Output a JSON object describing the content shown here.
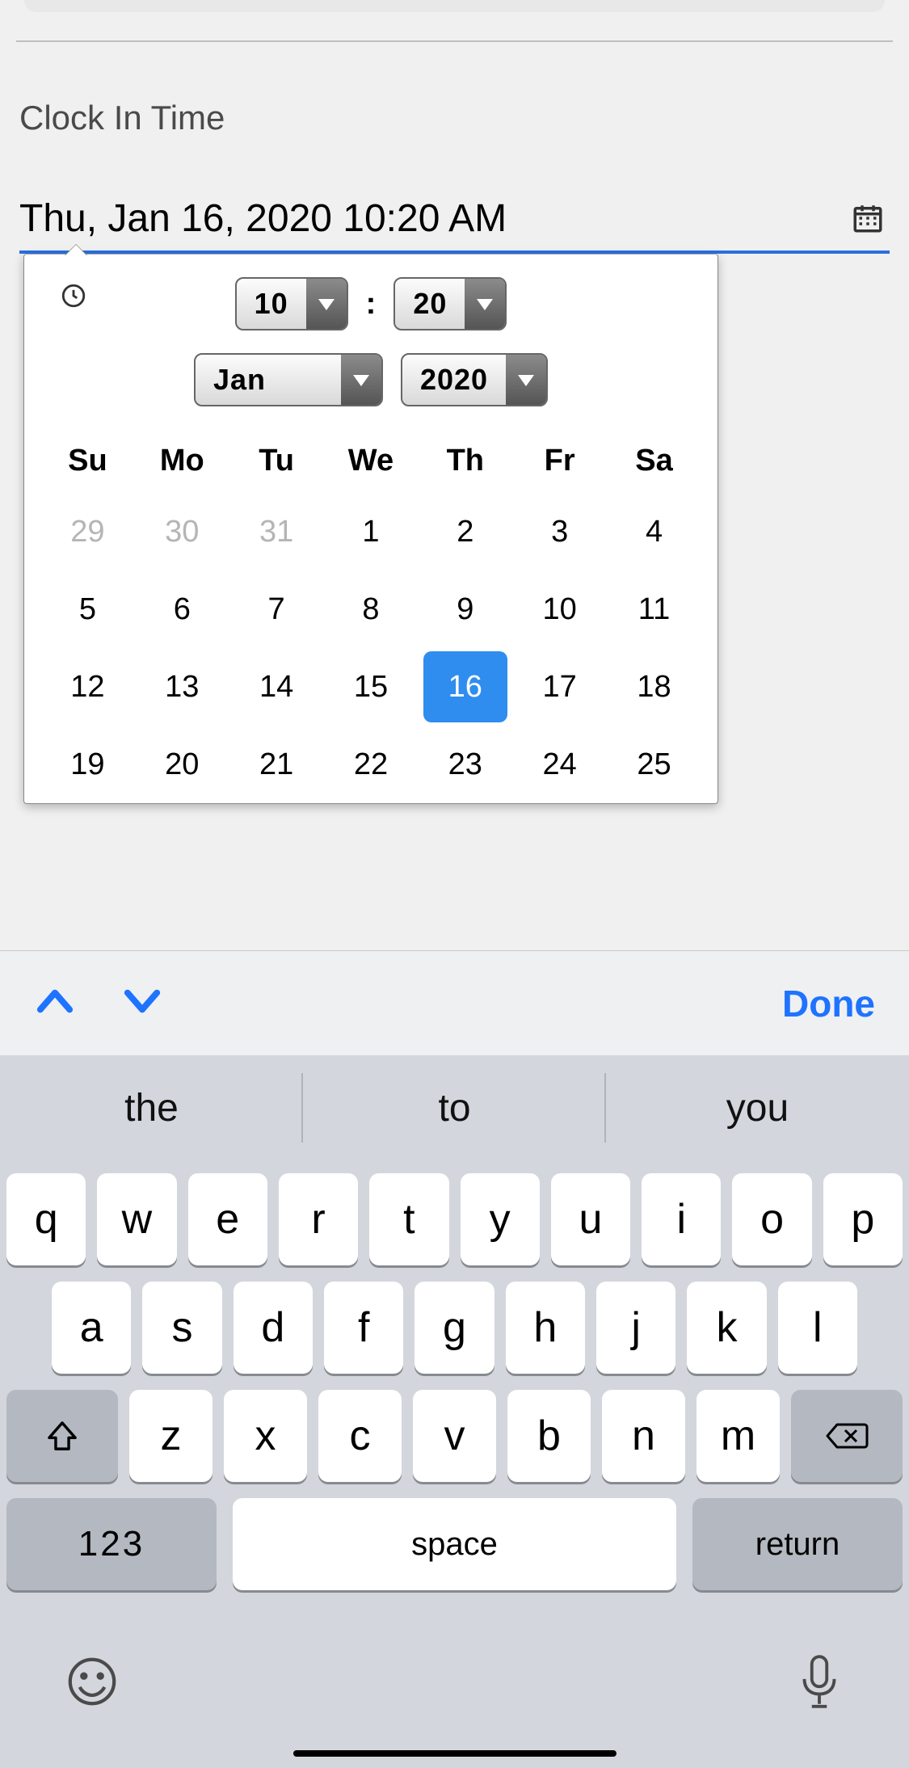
{
  "label": "Clock In Time",
  "field_value": "Thu, Jan 16, 2020 10:20 AM",
  "time": {
    "hour": "10",
    "minute": "20"
  },
  "monthyear": {
    "month": "Jan",
    "year": "2020"
  },
  "weekdays": [
    "Su",
    "Mo",
    "Tu",
    "We",
    "Th",
    "Fr",
    "Sa"
  ],
  "weeks": [
    [
      {
        "d": "29",
        "out": true
      },
      {
        "d": "30",
        "out": true
      },
      {
        "d": "31",
        "out": true
      },
      {
        "d": "1"
      },
      {
        "d": "2"
      },
      {
        "d": "3"
      },
      {
        "d": "4"
      }
    ],
    [
      {
        "d": "5"
      },
      {
        "d": "6"
      },
      {
        "d": "7"
      },
      {
        "d": "8"
      },
      {
        "d": "9"
      },
      {
        "d": "10"
      },
      {
        "d": "11"
      }
    ],
    [
      {
        "d": "12"
      },
      {
        "d": "13"
      },
      {
        "d": "14"
      },
      {
        "d": "15"
      },
      {
        "d": "16",
        "selected": true
      },
      {
        "d": "17"
      },
      {
        "d": "18"
      }
    ],
    [
      {
        "d": "19"
      },
      {
        "d": "20"
      },
      {
        "d": "21"
      },
      {
        "d": "22"
      },
      {
        "d": "23"
      },
      {
        "d": "24"
      },
      {
        "d": "25"
      }
    ]
  ],
  "accessory": {
    "done": "Done"
  },
  "suggestions": [
    "the",
    "to",
    "you"
  ],
  "keys": {
    "r1": [
      "q",
      "w",
      "e",
      "r",
      "t",
      "y",
      "u",
      "i",
      "o",
      "p"
    ],
    "r2": [
      "a",
      "s",
      "d",
      "f",
      "g",
      "h",
      "j",
      "k",
      "l"
    ],
    "r3": [
      "z",
      "x",
      "c",
      "v",
      "b",
      "n",
      "m"
    ],
    "num": "123",
    "space": "space",
    "return": "return"
  }
}
